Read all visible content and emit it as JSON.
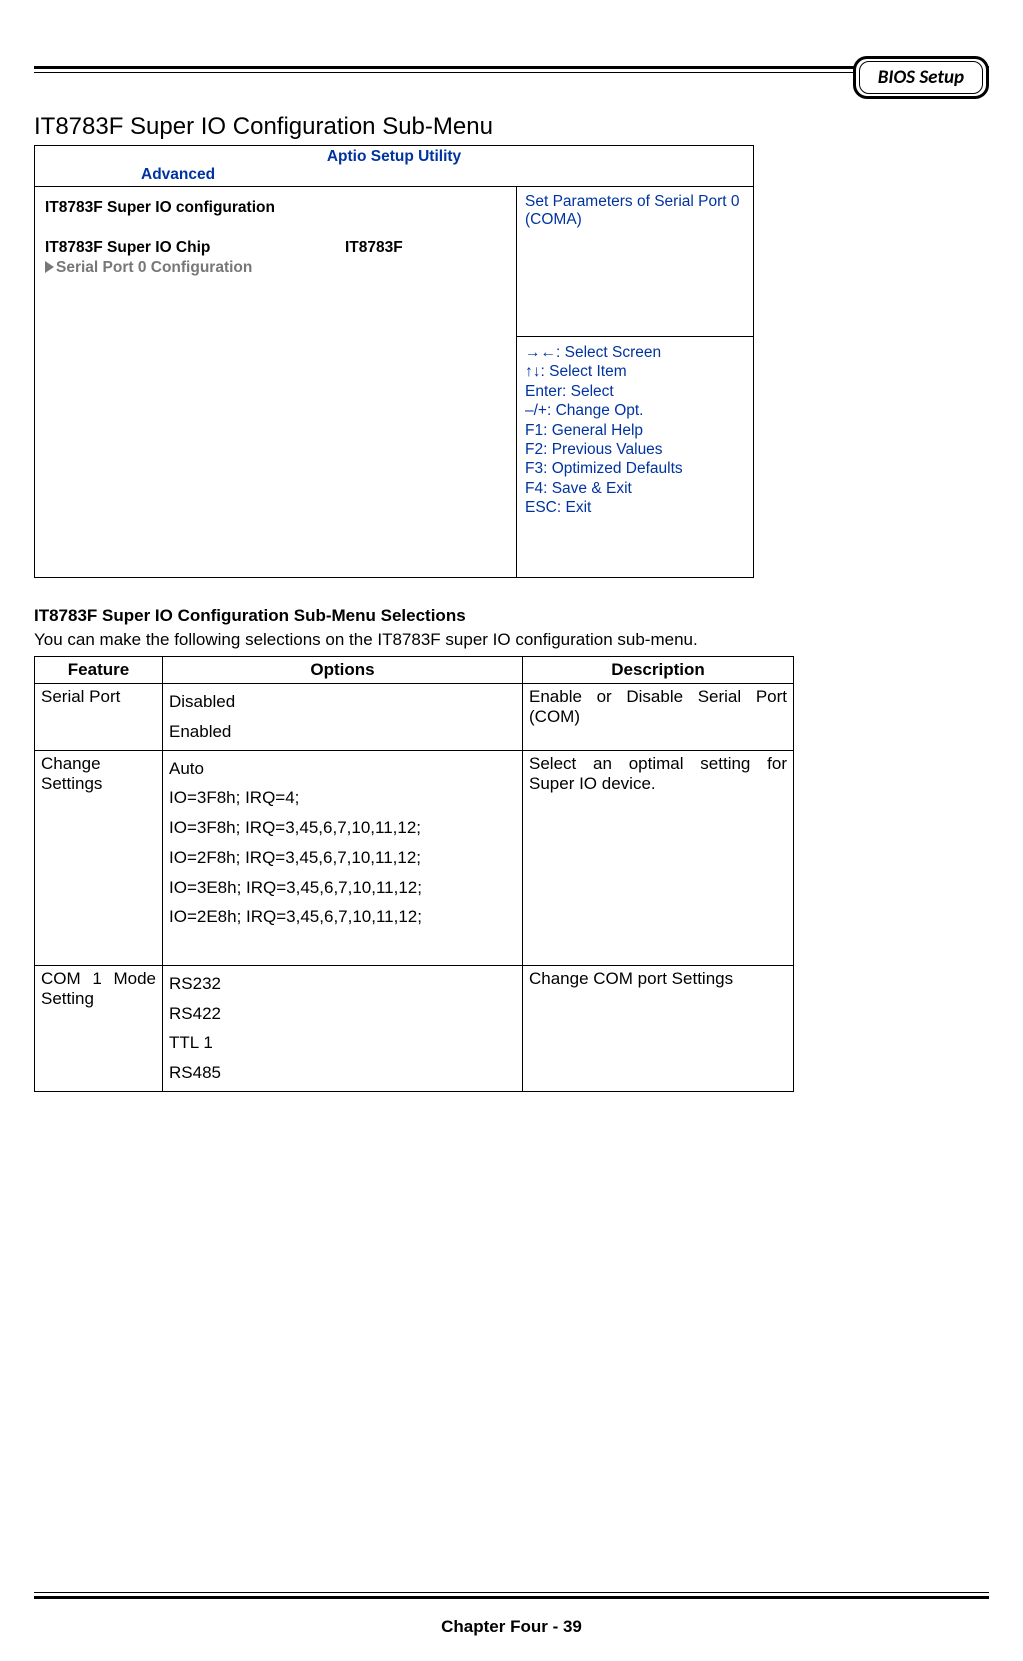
{
  "header": {
    "badge": "BIOS Setup"
  },
  "page_title": "IT8783F Super IO Configuration Sub-Menu",
  "bios": {
    "utility_title": "Aptio Setup Utility",
    "active_tab": "Advanced",
    "config_heading": "IT8783F Super IO configuration",
    "chip_label": "IT8783F Super IO Chip",
    "chip_value": "IT8783F",
    "submenu_label": "Serial Port 0 Configuration",
    "help_text": "Set Parameters of Serial Port 0 (COMA)",
    "keys": {
      "k1": "→←: Select Screen",
      "k2": "↑↓: Select Item",
      "k3": "Enter: Select",
      "k4": "–/+: Change Opt.",
      "k5": "F1: General Help",
      "k6": "F2: Previous Values",
      "k7": "F3: Optimized Defaults",
      "k8": "F4: Save & Exit",
      "k9": "ESC: Exit"
    }
  },
  "selections": {
    "heading": "IT8783F Super IO Configuration Sub-Menu Selections",
    "intro": "You can make the following selections on the IT8783F super IO configuration sub-menu.",
    "headers": {
      "feature": "Feature",
      "options": "Options",
      "description": "Description"
    },
    "rows": [
      {
        "feature": "Serial Port",
        "options": [
          "Disabled",
          "Enabled"
        ],
        "description": "Enable or Disable Serial Port (COM)"
      },
      {
        "feature": "Change Settings",
        "options": [
          "Auto",
          "IO=3F8h; IRQ=4;",
          "IO=3F8h; IRQ=3,45,6,7,10,11,12;",
          "IO=2F8h; IRQ=3,45,6,7,10,11,12;",
          "IO=3E8h; IRQ=3,45,6,7,10,11,12;",
          "IO=2E8h; IRQ=3,45,6,7,10,11,12;"
        ],
        "description": "Select an optimal setting for Super IO device."
      },
      {
        "feature": "COM 1 Mode Setting",
        "options": [
          "RS232",
          "RS422",
          "TTL 1",
          "RS485"
        ],
        "description": "Change COM port Settings"
      }
    ]
  },
  "footer": {
    "text": "Chapter Four - 39"
  }
}
